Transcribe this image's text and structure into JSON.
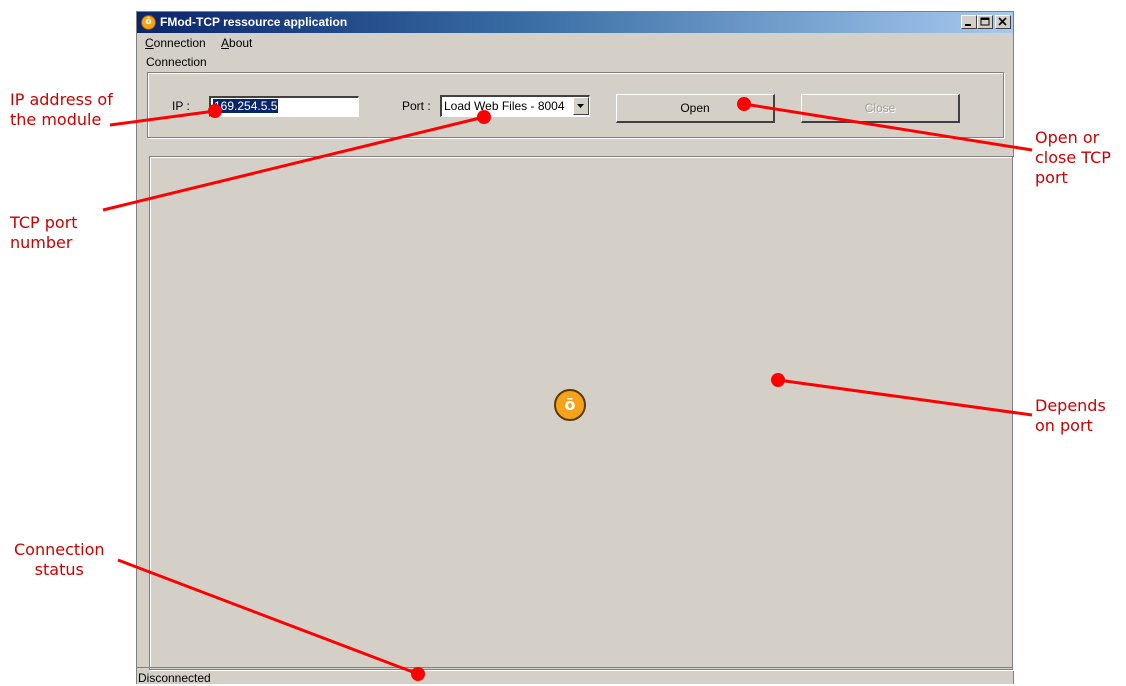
{
  "window": {
    "title": "FMod-TCP ressource application",
    "app_icon": "fmod-logo-icon",
    "controls": [
      "minimize-icon",
      "maximize-icon",
      "close-icon"
    ]
  },
  "menu": {
    "connection": {
      "accel": "C",
      "rest": "onnection"
    },
    "about": {
      "accel": "A",
      "rest": "bout"
    }
  },
  "connection_group": {
    "legend": "Connection",
    "ip_label": "IP :",
    "ip_value": "169.254.5.5",
    "port_label": "Port :",
    "port_value": "Load Web Files - 8004",
    "open_label": "Open",
    "close_label": "Close"
  },
  "status": {
    "text": "Disconnected"
  },
  "annotations": {
    "ip": [
      "IP address of",
      "the module"
    ],
    "port": [
      "TCP port",
      "number"
    ],
    "open_close": [
      "Open or",
      "close TCP",
      "port"
    ],
    "depends": [
      "Depends",
      "on port"
    ],
    "conn_status": [
      "Connection",
      "status"
    ]
  },
  "colors": {
    "annotation": "#cc0000",
    "window_face": "#d4d0c8",
    "titlebar_start": "#0a246a",
    "titlebar_end": "#a6caf0",
    "logo": "#f7a21b"
  }
}
